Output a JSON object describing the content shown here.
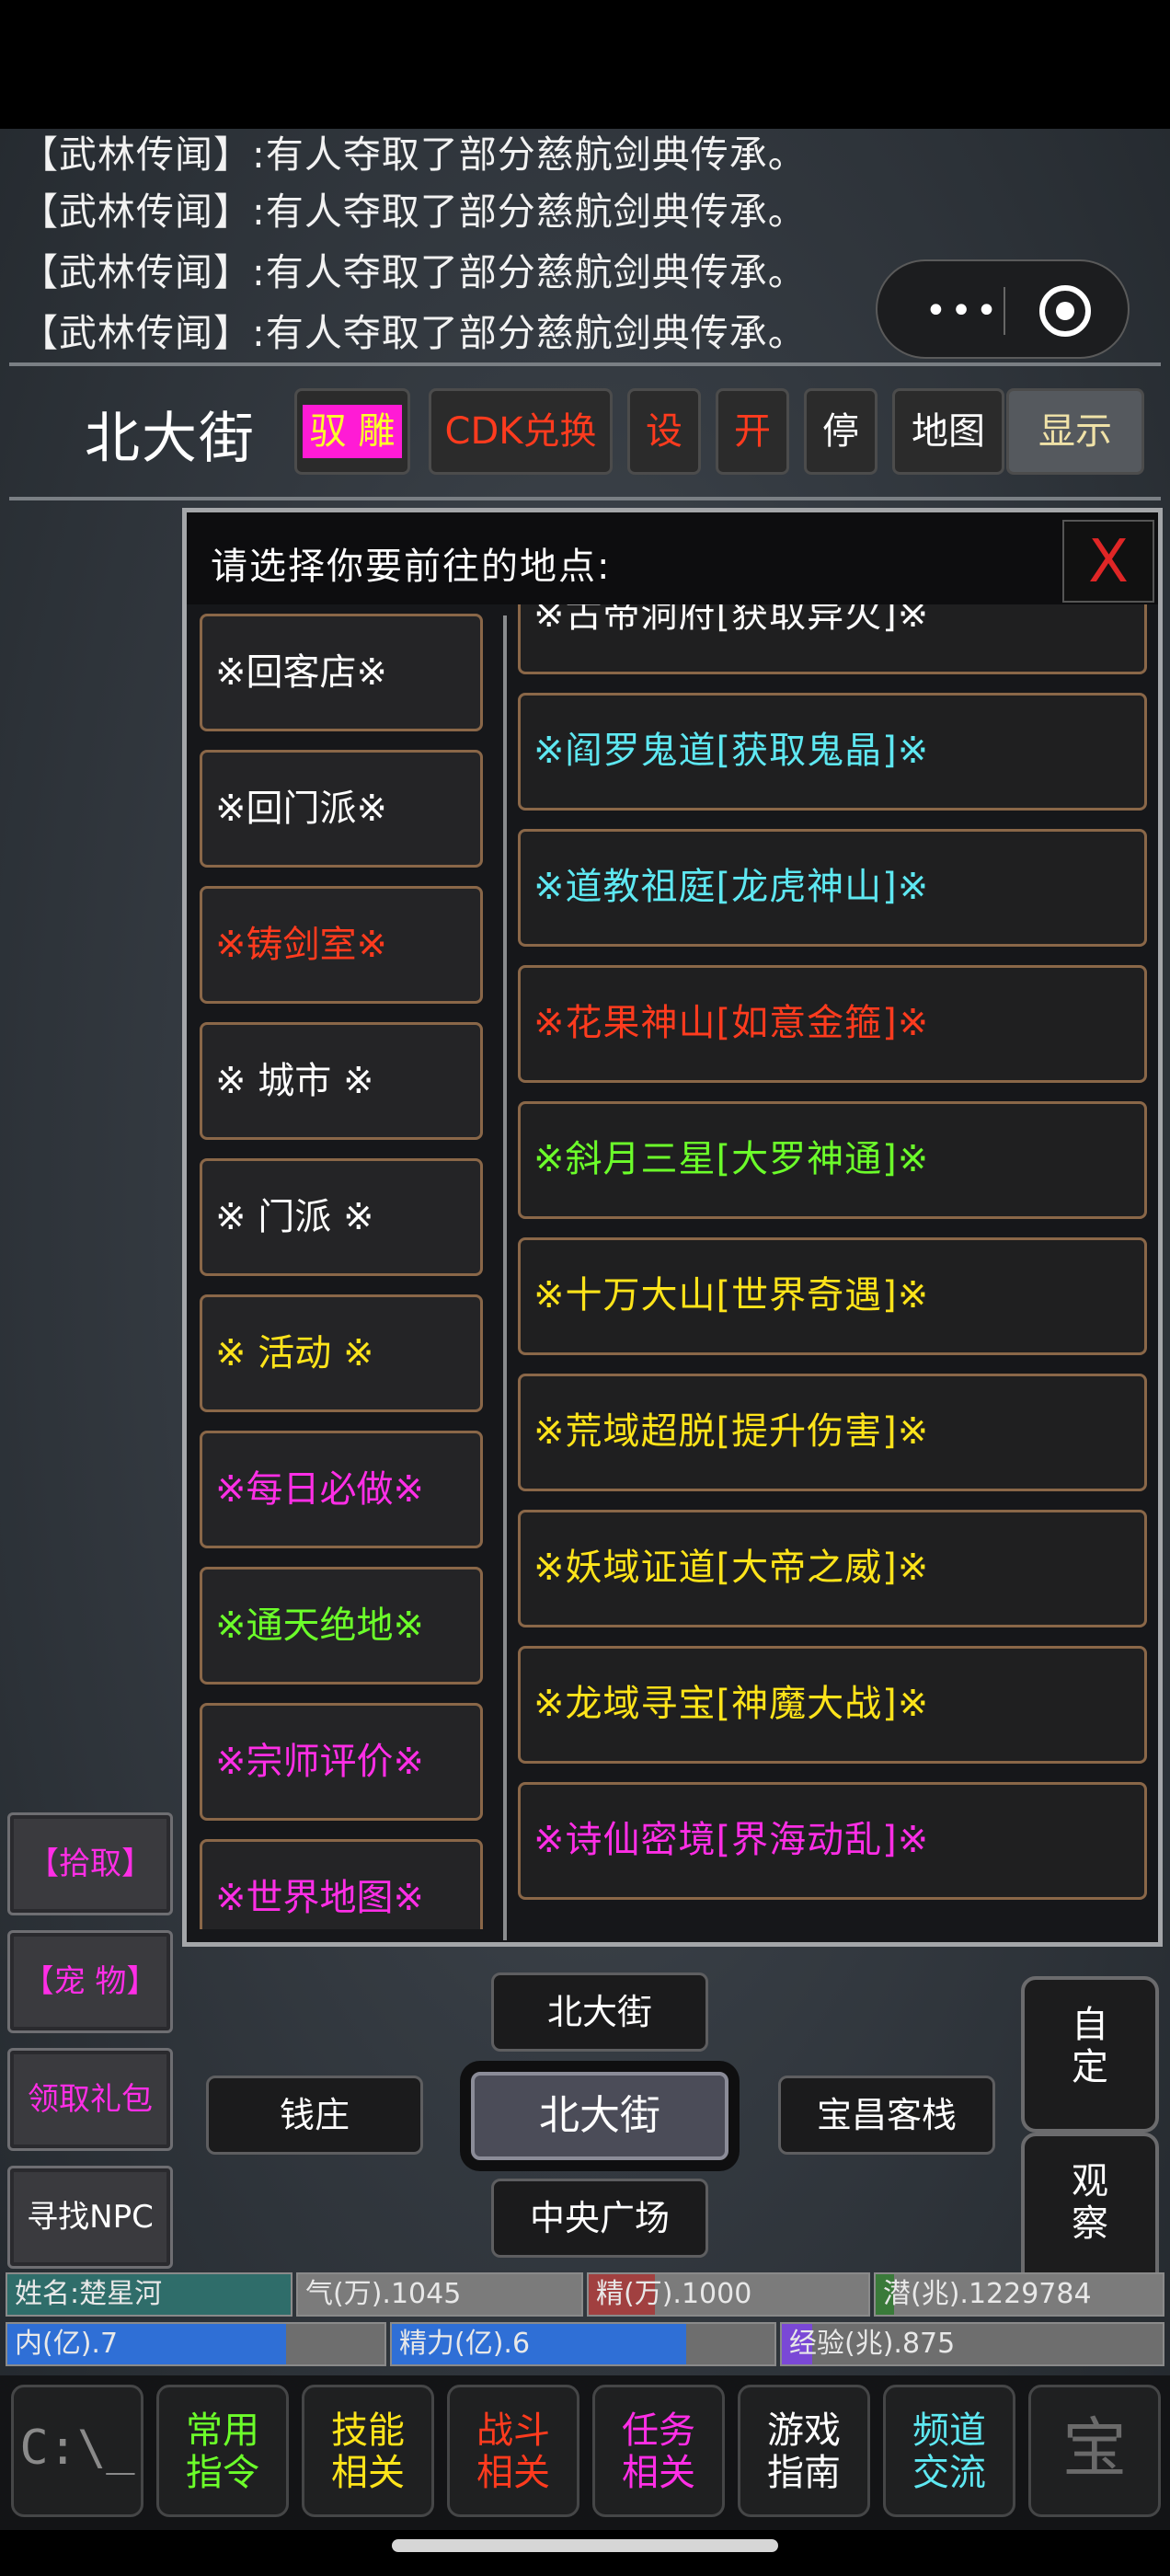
{
  "news": {
    "lines": [
      "【武林传闻】:有人夺取了部分慈航剑典传承。",
      "【武林传闻】:有人夺取了部分慈航剑典传承。",
      "【武林传闻】:有人夺取了部分慈航剑典传承。",
      "【武林传闻】:有人夺取了部分慈航剑典传承。"
    ]
  },
  "capsule": {
    "more": "•••"
  },
  "header": {
    "location": "北大街",
    "buttons": [
      {
        "label": "驭 雕",
        "color": "#fcff2a"
      },
      {
        "label": "CDK兑换",
        "color": "#ff3b1e"
      },
      {
        "label": "设",
        "color": "#ff3b1e"
      },
      {
        "label": "开",
        "color": "#ff3b1e"
      },
      {
        "label": "停",
        "color": "#ffffff"
      },
      {
        "label": "地图",
        "color": "#ffffff"
      },
      {
        "label": "显示",
        "color": "#f0e2a8"
      }
    ]
  },
  "dialog": {
    "title": "请选择你要前往的地点:",
    "close": "X",
    "left_items": [
      {
        "label": "※回客店※",
        "color": "#ffffff"
      },
      {
        "label": "※回门派※",
        "color": "#ffffff"
      },
      {
        "label": "※铸剑室※",
        "color": "#ff3b1e"
      },
      {
        "label": "※ 城市 ※",
        "color": "#ffffff"
      },
      {
        "label": "※ 门派 ※",
        "color": "#ffffff"
      },
      {
        "label": "※ 活动 ※",
        "color": "#ffe41a"
      },
      {
        "label": "※每日必做※",
        "color": "#ff2ee6"
      },
      {
        "label": "※通天绝地※",
        "color": "#6cff2a"
      },
      {
        "label": "※宗师评价※",
        "color": "#ff2ee6"
      },
      {
        "label": "※世界地图※",
        "color": "#ff2ee6"
      }
    ],
    "right_items": [
      {
        "label": "※古帝洞府[获取异火]※",
        "color": "#ffffff"
      },
      {
        "label": "※阎罗鬼道[获取鬼晶]※",
        "color": "#5ee8f2"
      },
      {
        "label": "※道教祖庭[龙虎神山]※",
        "color": "#5ee8f2"
      },
      {
        "label": "※花果神山[如意金箍]※",
        "color": "#ff3b1e"
      },
      {
        "label": "※斜月三星[大罗神通]※",
        "color": "#6cff2a"
      },
      {
        "label": "※十万大山[世界奇遇]※",
        "color": "#ffe41a"
      },
      {
        "label": "※荒域超脱[提升伤害]※",
        "color": "#ffe41a"
      },
      {
        "label": "※妖域证道[大帝之威]※",
        "color": "#ffe41a"
      },
      {
        "label": "※龙域寻宝[神魔大战]※",
        "color": "#ffe41a"
      },
      {
        "label": "※诗仙密境[界海动乱]※",
        "color": "#ff2ee6"
      }
    ]
  },
  "side_buttons": [
    {
      "label": "【拾取】",
      "color": "#ff2ee6"
    },
    {
      "label": "【宠 物】",
      "color": "#ff2ee6"
    },
    {
      "label": "领取礼包",
      "color": "#ff2ee6"
    },
    {
      "label": "寻找NPC",
      "color": "#ffffff"
    }
  ],
  "nav": {
    "north": "北大街",
    "west": "钱庄",
    "center": "北大街",
    "east": "宝昌客栈",
    "south": "中央广场",
    "custom": "自定",
    "observe": "观察"
  },
  "stats": {
    "name": "姓名:楚星河",
    "qi": "气(万).1045",
    "jing": "精(万).1000",
    "qian": "潜(兆).1229784",
    "nei": "内(亿).7",
    "jingli": "精力(亿).6",
    "exp": "经验(兆).875",
    "nei_fill": 0.74,
    "jingli_fill": 0.77,
    "exp_fill": 0.08
  },
  "menu": [
    {
      "label": "C:\\_",
      "color": "#8a8a8a"
    },
    {
      "label": "常用指令",
      "line1": "常用",
      "line2": "指令",
      "color": "#6cff2a"
    },
    {
      "label": "技能相关",
      "line1": "技能",
      "line2": "相关",
      "color": "#ffe41a"
    },
    {
      "label": "战斗相关",
      "line1": "战斗",
      "line2": "相关",
      "color": "#ff3b1e"
    },
    {
      "label": "任务相关",
      "line1": "任务",
      "line2": "相关",
      "color": "#ff2ee6"
    },
    {
      "label": "游戏指南",
      "line1": "游戏",
      "line2": "指南",
      "color": "#ffffff"
    },
    {
      "label": "频道交流",
      "line1": "频道",
      "line2": "交流",
      "color": "#5ee8f2"
    },
    {
      "label": "宝",
      "color": "#6a6a6a"
    }
  ]
}
